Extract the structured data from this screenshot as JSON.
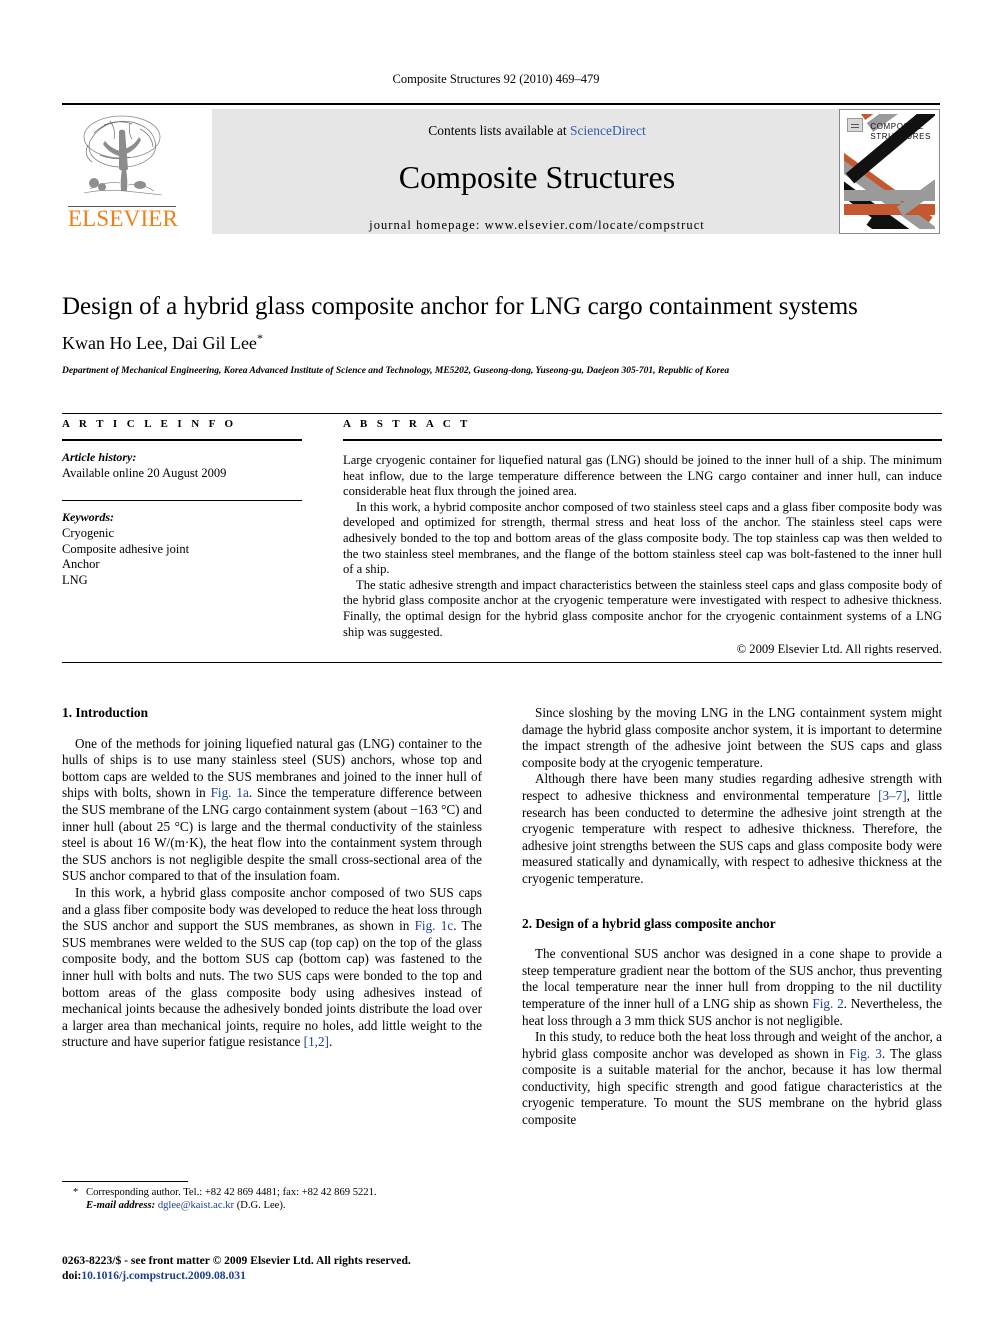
{
  "running_head": "Composite Structures 92 (2010) 469–479",
  "masthead": {
    "publisher": "ELSEVIER",
    "contents_prefix": "Contents lists available at ",
    "contents_link": "ScienceDirect",
    "journal_title": "Composite Structures",
    "homepage": "journal homepage: www.elsevier.com/locate/compstruct",
    "cover_line1": "COMPOSITE",
    "cover_line2": "STRUCTURES",
    "brand_orange": "#F07F17",
    "link_blue": "#2c5caa",
    "banner_bg": "#e6e6e6",
    "cover_orange": "#c4592f",
    "cover_gray": "#9a9a9a",
    "cover_black": "#111111"
  },
  "article": {
    "title": "Design of a hybrid glass composite anchor for LNG cargo containment systems",
    "authors": "Kwan Ho Lee, Dai Gil Lee",
    "corresponding_marker": "*",
    "affiliation": "Department of Mechanical Engineering, Korea Advanced Institute of Science and Technology, ME5202, Guseong-dong, Yuseong-gu, Daejeon 305-701, Republic of Korea"
  },
  "article_info": {
    "heading": "A R T I C L E    I N F O",
    "history_label": "Article history:",
    "history_value": "Available online 20 August 2009",
    "keywords_label": "Keywords:",
    "keywords": [
      "Cryogenic",
      "Composite adhesive joint",
      "Anchor",
      "LNG"
    ]
  },
  "abstract": {
    "heading": "A B S T R A C T",
    "paragraphs": [
      "Large cryogenic container for liquefied natural gas (LNG) should be joined to the inner hull of a ship. The minimum heat inflow, due to the large temperature difference between the LNG cargo container and inner hull, can induce considerable heat flux through the joined area.",
      "In this work, a hybrid composite anchor composed of two stainless steel caps and a glass fiber composite body was developed and optimized for strength, thermal stress and heat loss of the anchor. The stainless steel caps were adhesively bonded to the top and bottom areas of the glass composite body. The top stainless cap was then welded to the two stainless steel membranes, and the flange of the bottom stainless steel cap was bolt-fastened to the inner hull of a ship.",
      "The static adhesive strength and impact characteristics between the stainless steel caps and glass composite body of the hybrid glass composite anchor at the cryogenic temperature were investigated with respect to adhesive thickness. Finally, the optimal design for the hybrid glass composite anchor for the cryogenic containment systems of a LNG ship was suggested."
    ],
    "copyright": "© 2009 Elsevier Ltd. All rights reserved."
  },
  "body": {
    "left_column": {
      "section_heading": "1. Introduction",
      "paragraphs": [
        "One of the methods for joining liquefied natural gas (LNG) container to the hulls of ships is to use many stainless steel (SUS) anchors, whose top and bottom caps are welded to the SUS membranes and joined to the inner hull of ships with bolts, shown in Fig. 1a. Since the temperature difference between the SUS membrane of the LNG cargo containment system (about −163 °C) and inner hull (about 25 °C) is large and the thermal conductivity of the stainless steel is about 16 W/(m·K), the heat flow into the containment system through the SUS anchors is not negligible despite the small cross-sectional area of the SUS anchor compared to that of the insulation foam.",
        "In this work, a hybrid glass composite anchor composed of two SUS caps and a glass fiber composite body was developed to reduce the heat loss through the SUS anchor and support the SUS membranes, as shown in Fig. 1c. The SUS membranes were welded to the SUS cap (top cap) on the top of the glass composite body, and the bottom SUS cap (bottom cap) was fastened to the inner hull with bolts and nuts. The two SUS caps were bonded to the top and bottom areas of the glass composite body using adhesives instead of mechanical joints because the adhesively bonded joints distribute the load over a larger area than mechanical joints, require no holes, add little weight to the structure and have superior fatigue resistance [1,2]."
      ]
    },
    "right_column": {
      "paragraph_1": "Since sloshing by the moving LNG in the LNG containment system might damage the hybrid glass composite anchor system, it is important to determine the impact strength of the adhesive joint between the SUS caps and glass composite body at the cryogenic temperature.",
      "paragraph_2": "Although there have been many studies regarding adhesive strength with respect to adhesive thickness and environmental temperature [3–7], little research has been conducted to determine the adhesive joint strength at the cryogenic temperature with respect to adhesive thickness. Therefore, the adhesive joint strengths between the SUS caps and glass composite body were measured statically and dynamically, with respect to adhesive thickness at the cryogenic temperature.",
      "section_heading": "2. Design of a hybrid glass composite anchor",
      "paragraph_3": "The conventional SUS anchor was designed in a cone shape to provide a steep temperature gradient near the bottom of the SUS anchor, thus preventing the local temperature near the inner hull from dropping to the nil ductility temperature of the inner hull of a LNG ship as shown Fig. 2. Nevertheless, the heat loss through a 3 mm thick SUS anchor is not negligible.",
      "paragraph_4": "In this study, to reduce both the heat loss through and weight of the anchor, a hybrid glass composite anchor was developed as shown in Fig. 3. The glass composite is a suitable material for the anchor, because it has low thermal conductivity, high specific strength and good fatigue characteristics at the cryogenic temperature. To mount the SUS membrane on the hybrid glass composite"
    }
  },
  "footnotes": {
    "corresponding": "Corresponding author. Tel.: +82 42 869 4481; fax: +82 42 869 5221.",
    "email_label": "E-mail address:",
    "email_value": "dglee@kaist.ac.kr",
    "email_suffix": "(D.G. Lee).",
    "issn_line": "0263-8223/$ - see front matter © 2009 Elsevier Ltd. All rights reserved.",
    "doi_label": "doi:",
    "doi_value": "10.1016/j.compstruct.2009.08.031"
  }
}
